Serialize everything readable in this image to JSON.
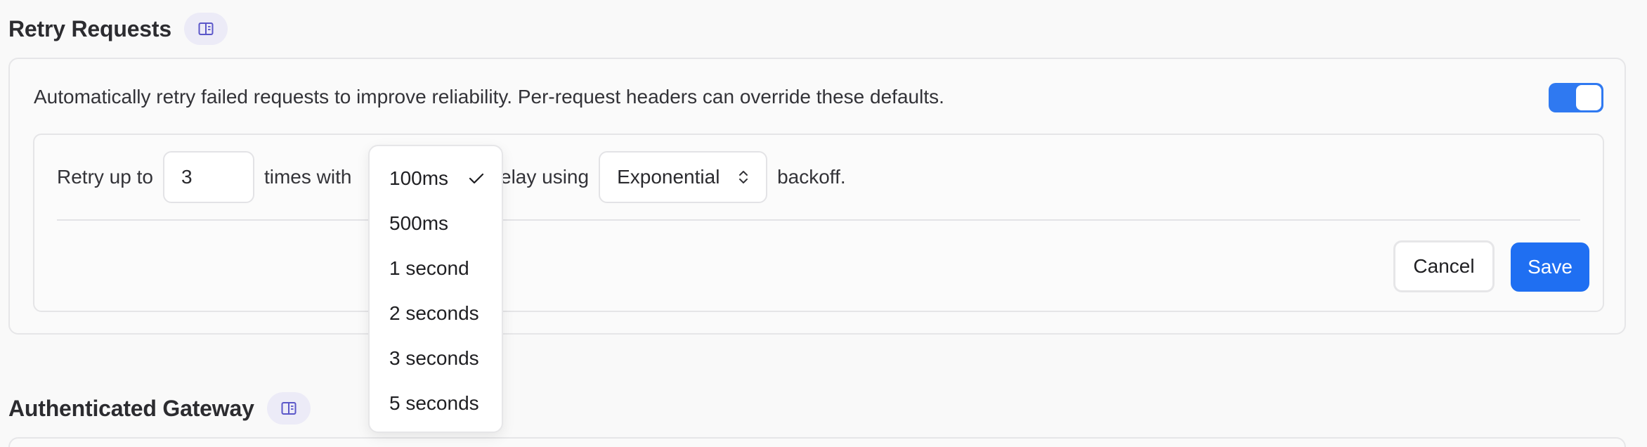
{
  "retry": {
    "title": "Retry Requests",
    "description": "Automatically retry failed requests to improve reliability. Per-request headers can override these defaults.",
    "enabled": true,
    "row": {
      "prefix": "Retry up to",
      "count_value": "3",
      "middle": "times with",
      "after_delay": "delay using",
      "backoff_value": "Exponential",
      "suffix": "backoff."
    },
    "buttons": {
      "cancel": "Cancel",
      "save": "Save"
    }
  },
  "delay_dropdown": {
    "selected": "100ms",
    "options": [
      "100ms",
      "500ms",
      "1 second",
      "2 seconds",
      "3 seconds",
      "5 seconds"
    ]
  },
  "gateway": {
    "title": "Authenticated Gateway"
  },
  "colors": {
    "accent": "#1f6ff2",
    "toggle_on": "#2f79f1",
    "badge_bg": "#ecebf7",
    "badge_icon": "#5b57c9"
  }
}
